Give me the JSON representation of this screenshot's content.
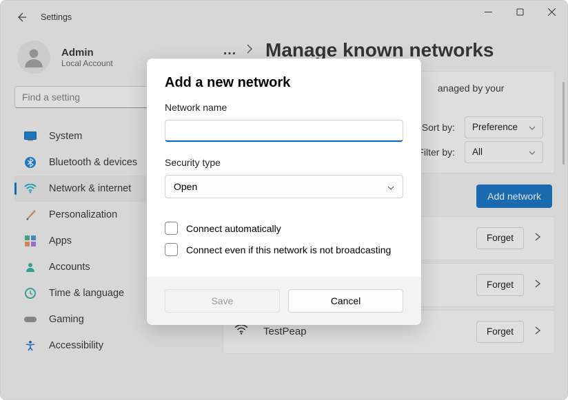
{
  "titlebar": {
    "title": "Settings"
  },
  "user": {
    "name": "Admin",
    "subtitle": "Local Account"
  },
  "search": {
    "placeholder": "Find a setting"
  },
  "nav": {
    "system": "System",
    "bluetooth": "Bluetooth & devices",
    "network": "Network & internet",
    "personalization": "Personalization",
    "apps": "Apps",
    "accounts": "Accounts",
    "time": "Time & language",
    "gaming": "Gaming",
    "accessibility": "Accessibility"
  },
  "main": {
    "page_title": "Manage known networks",
    "desc_suffix": "anaged by your",
    "sort_label": "Sort by:",
    "sort_value": "Preference",
    "filter_label": "Filter by:",
    "filter_value": "All",
    "add_button": "Add network",
    "forget_label": "Forget",
    "networks": [
      "",
      "",
      "TestPeap"
    ]
  },
  "dialog": {
    "title": "Add a new network",
    "name_label": "Network name",
    "name_value": "",
    "security_label": "Security type",
    "security_value": "Open",
    "auto_label": "Connect automatically",
    "hidden_label": "Connect even if this network is not broadcasting",
    "save": "Save",
    "cancel": "Cancel"
  }
}
